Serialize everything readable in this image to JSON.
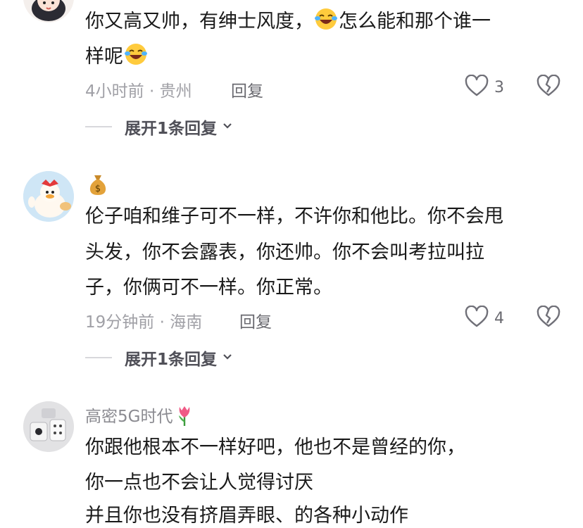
{
  "comments": [
    {
      "lines": [
        "你又高又帅，有绅士风度，",
        "怎么能和那个谁一",
        "样呢"
      ],
      "time": "4小时前",
      "location": "贵州",
      "reply_label": "回复",
      "likes": "3",
      "expand_label": "展开1条回复"
    },
    {
      "user_emoji": "money-bag-emoji",
      "lines": [
        "伦子咱和维子可不一样，不许你和他比。你不会甩",
        "头发，你不会露表，你还帅。你不会叫考拉叫拉",
        "子，你俩可不一样。你正常。"
      ],
      "time": "19分钟前",
      "location": "海南",
      "reply_label": "回复",
      "likes": "4",
      "expand_label": "展开1条回复"
    },
    {
      "username": "高密5G时代",
      "username_emoji": "tulip-emoji",
      "lines": [
        "你跟他根本不一样好吧，他也不是曾经的你，",
        "你一点也不会让人觉得讨厌",
        "并且你也没有挤眉弄眼、的各种小动作"
      ]
    }
  ],
  "separator": " · "
}
